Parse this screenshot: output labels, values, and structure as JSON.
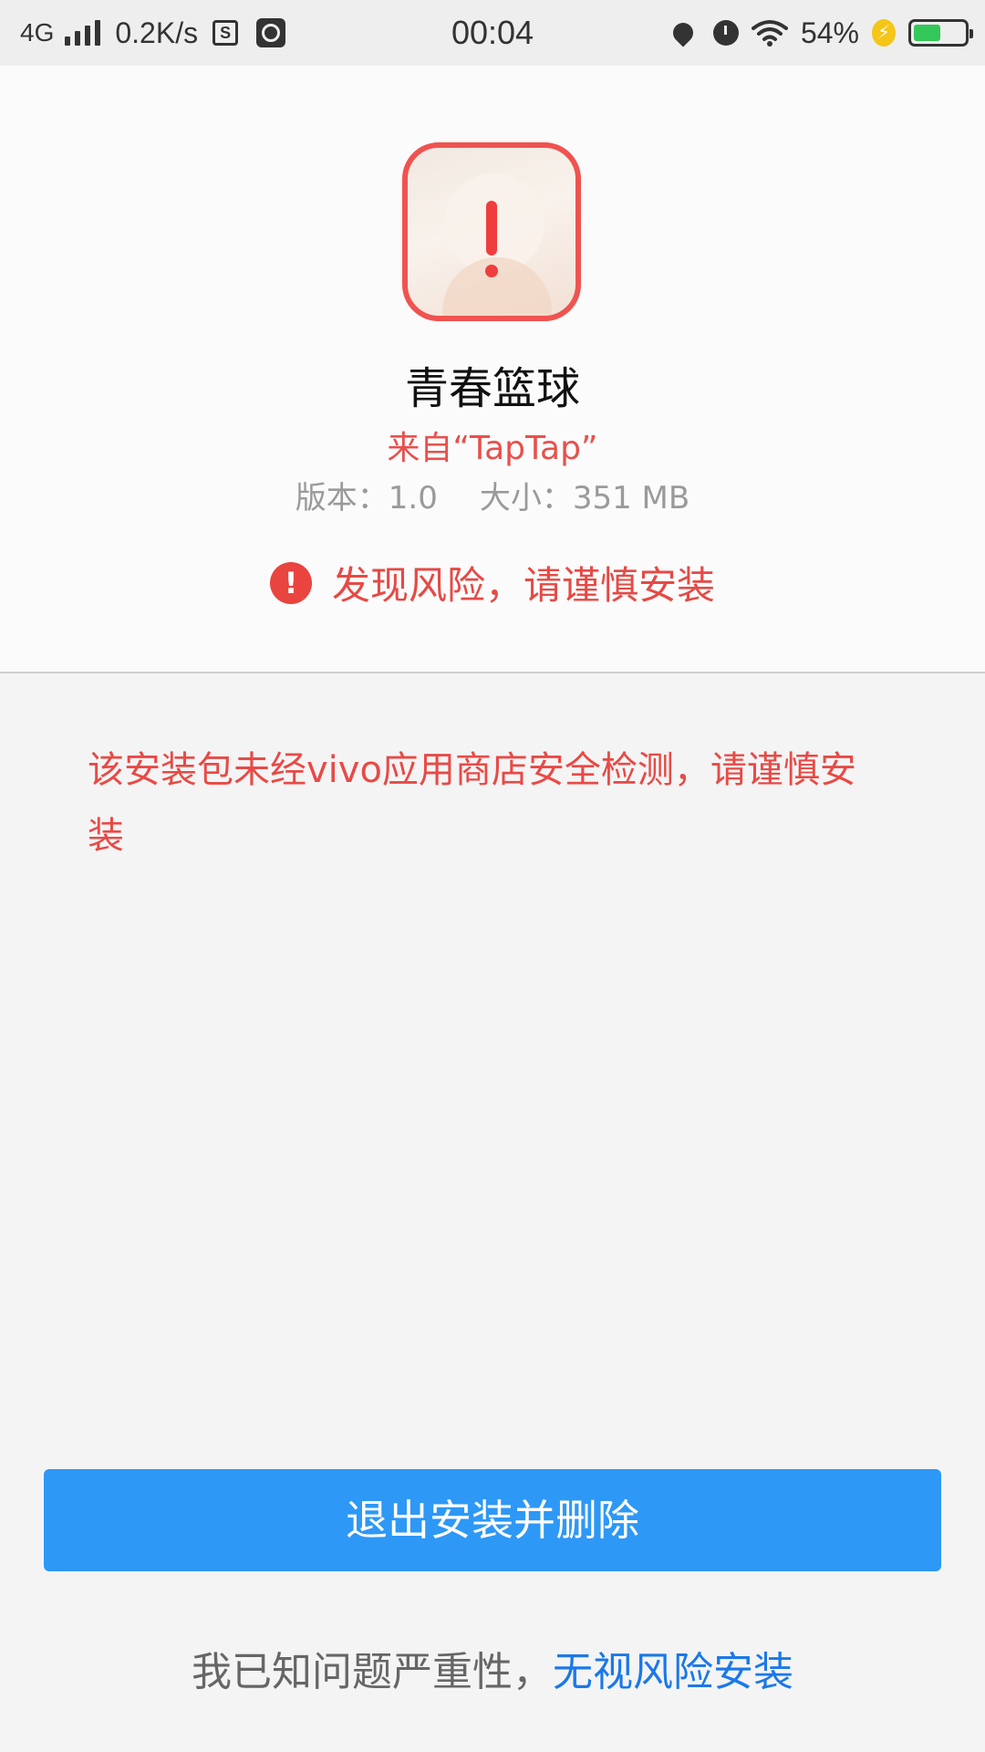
{
  "status_bar": {
    "network": "4G",
    "speed": "0.2K/s",
    "time": "00:04",
    "battery_pct": "54%",
    "battery_level": 0.54,
    "icons": [
      "signal-icon",
      "storage-icon",
      "gauge-icon",
      "location-icon",
      "alarm-icon",
      "wifi-icon",
      "charging-icon",
      "battery-icon"
    ]
  },
  "app": {
    "name": "青春篮球",
    "source": "来自“TapTap”",
    "version": "版本：1.0",
    "size": "大小：351 MB",
    "risk_text": "发现风险，请谨慎安装",
    "risk_icon_glyph": "!"
  },
  "warning": {
    "description": "该安装包未经vivo应用商店安全检测，请谨慎安装"
  },
  "actions": {
    "exit_label": "退出安装并删除",
    "ack_text": "我已知问题严重性，",
    "ignore_label": "无视风险安装"
  },
  "colors": {
    "primary_button": "#2d98f6",
    "warning_red": "#e84a45",
    "link_blue": "#1b78e8"
  }
}
